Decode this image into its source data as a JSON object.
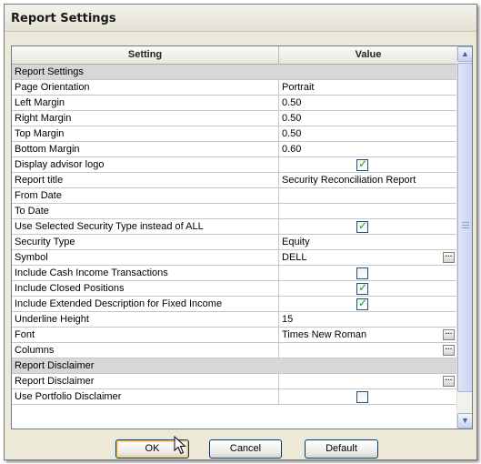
{
  "dialog": {
    "title": "Report Settings"
  },
  "grid": {
    "columns": {
      "setting": "Setting",
      "value": "Value"
    },
    "rows": [
      {
        "type": "category",
        "setting": "Report Settings"
      },
      {
        "type": "text",
        "setting": "Page Orientation",
        "value": "Portrait"
      },
      {
        "type": "text",
        "setting": "Left Margin",
        "value": "0.50"
      },
      {
        "type": "text",
        "setting": "Right Margin",
        "value": "0.50"
      },
      {
        "type": "text",
        "setting": "Top Margin",
        "value": "0.50"
      },
      {
        "type": "text",
        "setting": "Bottom Margin",
        "value": "0.60"
      },
      {
        "type": "checkbox",
        "setting": "Display advisor logo",
        "checked": true
      },
      {
        "type": "text",
        "setting": "Report title",
        "value": "Security Reconciliation Report"
      },
      {
        "type": "text",
        "setting": "From Date",
        "value": ""
      },
      {
        "type": "text",
        "setting": "To Date",
        "value": ""
      },
      {
        "type": "checkbox",
        "setting": "Use Selected Security Type instead of ALL",
        "checked": true
      },
      {
        "type": "text",
        "setting": "Security Type",
        "value": "Equity"
      },
      {
        "type": "button",
        "setting": "Symbol",
        "value": "DELL"
      },
      {
        "type": "checkbox",
        "setting": "Include Cash Income Transactions",
        "checked": false
      },
      {
        "type": "checkbox",
        "setting": "Include Closed Positions",
        "checked": true
      },
      {
        "type": "checkbox",
        "setting": "Include Extended Description for Fixed Income",
        "checked": true
      },
      {
        "type": "text",
        "setting": "Underline Height",
        "value": "15"
      },
      {
        "type": "button",
        "setting": "Font",
        "value": "Times New Roman"
      },
      {
        "type": "button",
        "setting": "Columns",
        "value": ""
      },
      {
        "type": "category",
        "setting": "Report Disclaimer"
      },
      {
        "type": "button",
        "setting": "Report Disclaimer",
        "value": ""
      },
      {
        "type": "checkbox",
        "setting": "Use Portfolio Disclaimer",
        "checked": false
      }
    ]
  },
  "buttons": {
    "ok": "OK",
    "cancel": "Cancel",
    "default": "Default"
  },
  "icons": {
    "check": "✓",
    "ellipsis": "···",
    "scroll_up": "▲",
    "scroll_down": "▼"
  },
  "colors": {
    "check_green": "#21a121",
    "category_bg": "#d7d7d7",
    "focus_ring": "#f3c061"
  }
}
